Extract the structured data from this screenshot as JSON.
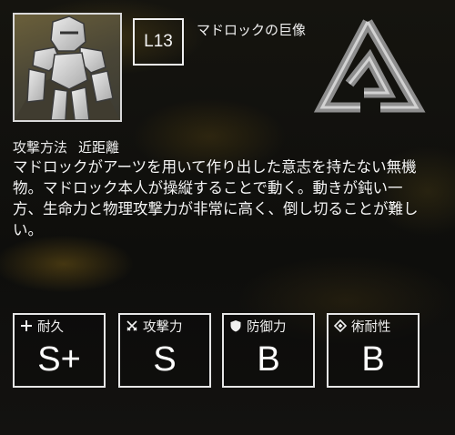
{
  "enemy": {
    "level": "L13",
    "name": "マドロックの巨像",
    "attack_label": "攻撃方法",
    "attack_value": "近距離",
    "description": "マドロックがアーツを用いて作り出した意志を持たない無機物。マドロック本人が操縦することで動く。動きが鈍い一方、生命力と物理攻撃力が非常に高く、倒し切ることが難しい。"
  },
  "stats": [
    {
      "label": "耐久",
      "grade": "S+",
      "icon": "plus-icon"
    },
    {
      "label": "攻撃力",
      "grade": "S",
      "icon": "crossed-swords-icon"
    },
    {
      "label": "防御力",
      "grade": "B",
      "icon": "shield-icon"
    },
    {
      "label": "術耐性",
      "grade": "B",
      "icon": "diamond-icon"
    }
  ],
  "colors": {
    "frame": "#e6e6e6",
    "text": "#f2f2f2",
    "accent": "#8a6d1f"
  }
}
